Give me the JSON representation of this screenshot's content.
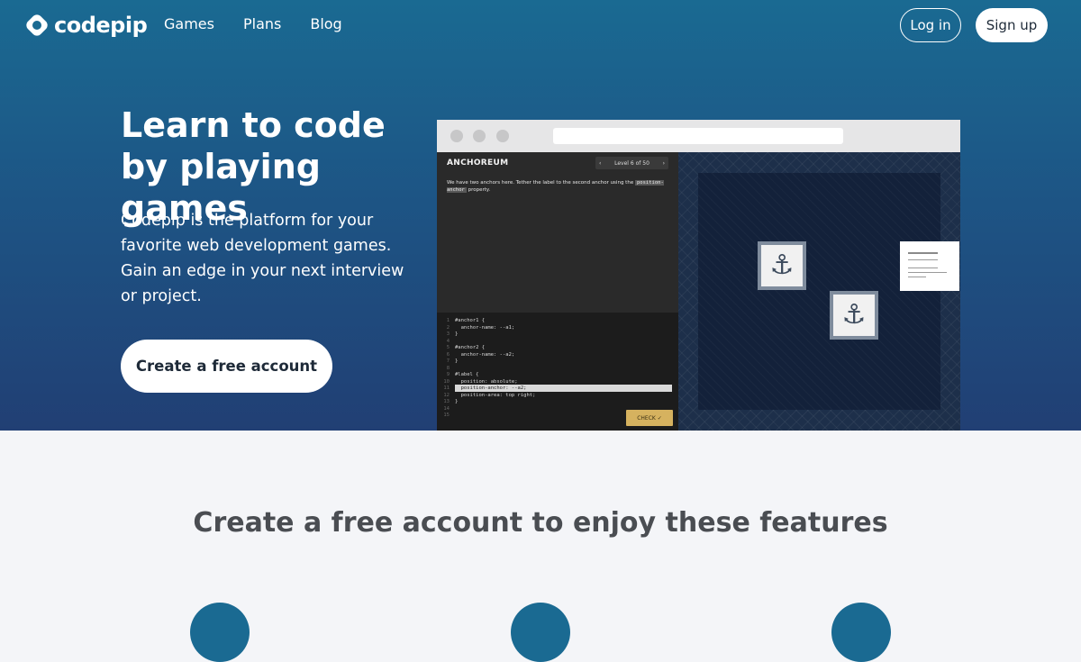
{
  "brand": {
    "name": "codepip"
  },
  "nav": {
    "links": [
      {
        "label": "Games"
      },
      {
        "label": "Plans"
      },
      {
        "label": "Blog"
      }
    ],
    "login_label": "Log in",
    "signup_label": "Sign up"
  },
  "hero": {
    "title": "Learn to code by playing games",
    "description": "Codepip is the platform for your favorite web development games. Gain an edge in your next interview or project.",
    "cta_label": "Create a free account"
  },
  "game": {
    "name": "ANCHOREUM",
    "level_label": "Level 6 of 50",
    "level_prev": "‹",
    "level_next": "›",
    "instructions_before": "We have two anchors here. Tether the label to the second anchor using the",
    "instructions_code": "position-anchor",
    "instructions_after": "property.",
    "code_lines": [
      {
        "n": "1",
        "text": "#anchor1 {"
      },
      {
        "n": "2",
        "text": "  anchor-name: --a1;"
      },
      {
        "n": "3",
        "text": "}"
      },
      {
        "n": "4",
        "text": ""
      },
      {
        "n": "5",
        "text": "#anchor2 {"
      },
      {
        "n": "6",
        "text": "  anchor-name: --a2;"
      },
      {
        "n": "7",
        "text": "}"
      },
      {
        "n": "8",
        "text": ""
      },
      {
        "n": "9",
        "text": "#label {"
      },
      {
        "n": "10",
        "text": "  position: absolute;"
      },
      {
        "n": "11",
        "text": "  position-anchor: --a2;"
      },
      {
        "n": "12",
        "text": "  position-area: top right;"
      },
      {
        "n": "13",
        "text": "}"
      },
      {
        "n": "14",
        "text": ""
      },
      {
        "n": "15",
        "text": ""
      }
    ],
    "highlighted_line": 11,
    "check_label": "CHECK ✓",
    "anchor_glyph": "⚓"
  },
  "features": {
    "title": "Create a free account to enjoy these features"
  },
  "colors": {
    "accent": "#1a6a92",
    "check_button": "#d6b25f"
  }
}
